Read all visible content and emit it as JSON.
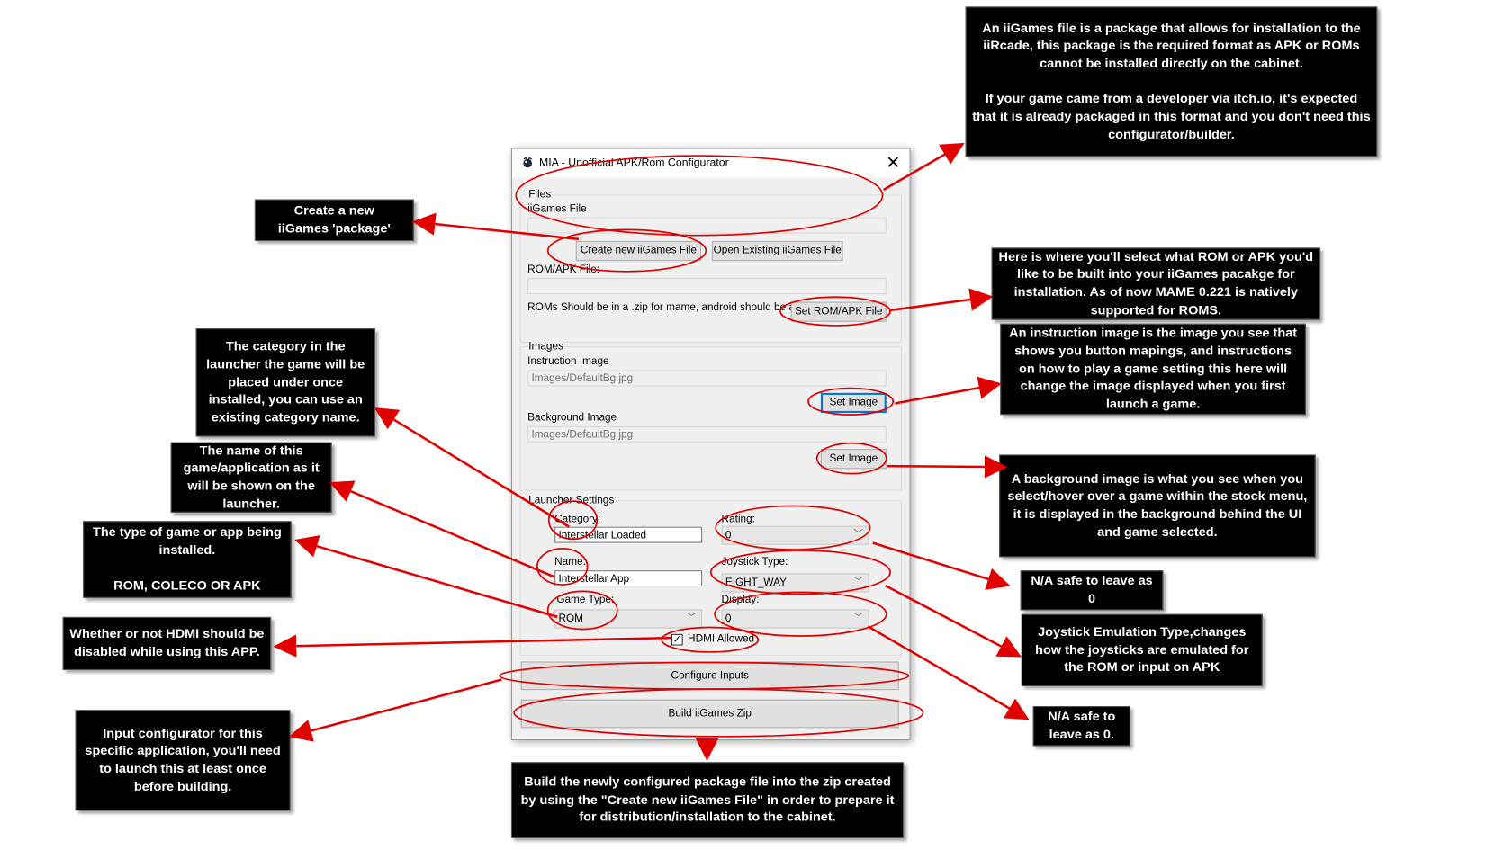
{
  "dialog": {
    "title": "MIA - Unofficial APK/Rom Configurator",
    "close_icon": "close-icon",
    "app_icon": "app-icon",
    "files_group": {
      "legend": "Files",
      "iigames_label": "iiGames File",
      "iigames_value": "",
      "create_button": "Create new iiGames File",
      "open_button": "Open Existing iiGames File",
      "rom_label": "ROM/APK File:",
      "rom_value": "",
      "rom_hint": "ROMs Should be in a .zip for mame, android should be apk",
      "set_rom_button": "Set ROM/APK File"
    },
    "images_group": {
      "legend": "Images",
      "instruction_label": "Instruction Image",
      "instruction_value": "Images/DefaultBg.jpg",
      "set_instruction_button": "Set Image",
      "background_label": "Background Image",
      "background_value": "Images/DefaultBg.jpg",
      "set_background_button": "Set Image"
    },
    "launcher_group": {
      "legend": "Launcher Settings",
      "category_label": "Category:",
      "category_value": "Interstellar Loaded",
      "name_label": "Name:",
      "name_value": "Interstellar App",
      "game_type_label": "Game Type:",
      "game_type_value": "ROM",
      "rating_label": "Rating:",
      "rating_value": "0",
      "joystick_label": "Joystick Type:",
      "joystick_value": "EIGHT_WAY",
      "display_label": "Display:",
      "display_value": "0",
      "hdmi_label": "HDMI Allowed",
      "hdmi_checked": true,
      "check_glyph": "✓"
    },
    "configure_button": "Configure Inputs",
    "build_button": "Build iiGames Zip",
    "chevron_glyph": "﹀",
    "close_glyph": "✕"
  },
  "annotations": {
    "iigames_file": "An iiGames file is a package that allows for installation to the iiRcade, this package is the required format as APK or ROMs cannot be installed directly on the cabinet.\n\nIf your game came from a developer via itch.io, it's expected that it is already packaged in this format and you don't need this configurator/builder.",
    "create_new": "Create a new\niiGames 'package'",
    "rom_apk": "Here is where you'll select what ROM or APK you'd like to be built into your iiGames pacakge for installation. As of now MAME 0.221 is natively supported for ROMS.",
    "instruction_image": "An instruction image is the image you see that shows you button mapings, and instructions on how to play a game setting this here will change the image displayed when you first launch a game.",
    "category": "The category in the launcher the game will be placed under once installed, you can use an existing category name.",
    "name": "The name of this game/application as it will be shown on the launcher.",
    "background_image": "A background image is what you see when you select/hover over a game within the stock menu, it is displayed in the background behind the UI and game selected.",
    "game_type": "The type of game or app being installed.\n\nROM, COLECO OR APK",
    "rating": "N/A safe to leave as 0",
    "joystick": "Joystick Emulation Type,changes how the joysticks are emulated for the ROM or input on APK",
    "hdmi": "Whether or not HDMI should be disabled while using this APP.",
    "display": "N/A safe to leave as 0.",
    "configure_inputs": "Input configurator for this specific application, you'll need to launch this at least once before building.",
    "build_zip": "Build the newly configured package file into the zip created by using the \"Create new iiGames File\" in order to prepare it for distribution/installation to the cabinet."
  },
  "colors": {
    "annotation_red": "#e00000",
    "note_bg": "#000000",
    "note_text": "#ffffff",
    "dialog_bg": "#f0f0f0",
    "focus_blue": "#0078d7"
  }
}
